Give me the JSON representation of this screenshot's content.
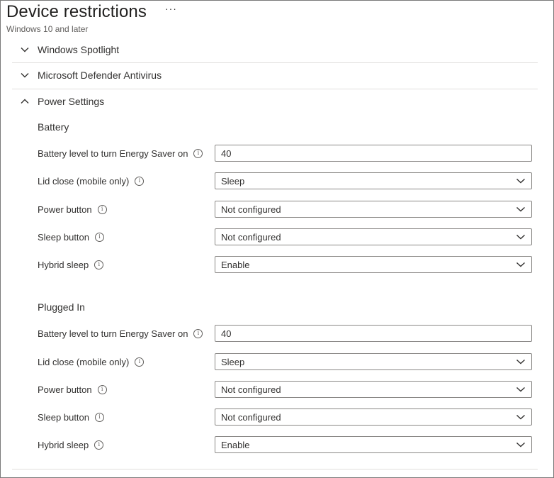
{
  "header": {
    "title": "Device restrictions",
    "more": "···",
    "subtitle": "Windows 10 and later"
  },
  "sections": [
    {
      "label": "Windows Spotlight",
      "expanded": false
    },
    {
      "label": "Microsoft Defender Antivirus",
      "expanded": false
    },
    {
      "label": "Power Settings",
      "expanded": true
    }
  ],
  "power": {
    "battery": {
      "title": "Battery",
      "energy_saver_label": "Battery level to turn Energy Saver on",
      "energy_saver_value": "40",
      "lid_close_label": "Lid close (mobile only)",
      "lid_close_value": "Sleep",
      "power_button_label": "Power button",
      "power_button_value": "Not configured",
      "sleep_button_label": "Sleep button",
      "sleep_button_value": "Not configured",
      "hybrid_sleep_label": "Hybrid sleep",
      "hybrid_sleep_value": "Enable"
    },
    "plugged_in": {
      "title": "Plugged In",
      "energy_saver_label": "Battery level to turn Energy Saver on",
      "energy_saver_value": "40",
      "lid_close_label": "Lid close (mobile only)",
      "lid_close_value": "Sleep",
      "power_button_label": "Power button",
      "power_button_value": "Not configured",
      "sleep_button_label": "Sleep button",
      "sleep_button_value": "Not configured",
      "hybrid_sleep_label": "Hybrid sleep",
      "hybrid_sleep_value": "Enable"
    }
  },
  "icons": {
    "info": "info-circle-icon",
    "collapse": "chevron-down-icon",
    "expand": "chevron-up-icon",
    "dropdown": "chevron-down-icon"
  },
  "colors": {
    "text": "#323130",
    "border": "#8a8886",
    "divider": "#e1dfdd"
  }
}
